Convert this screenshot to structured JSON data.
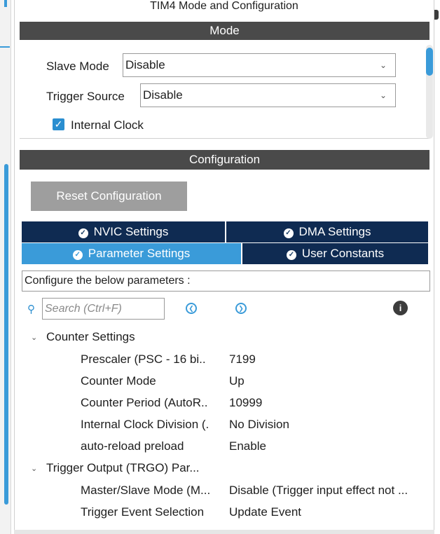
{
  "window": {
    "title": "TIM4 Mode and Configuration"
  },
  "mode_section": {
    "header": "Mode",
    "slave_mode": {
      "label": "Slave Mode",
      "value": "Disable"
    },
    "trigger_source": {
      "label": "Trigger Source",
      "value": "Disable"
    },
    "internal_clock": {
      "label": "Internal Clock",
      "checked": true
    }
  },
  "configuration_section": {
    "header": "Configuration",
    "reset_button": "Reset Configuration",
    "tabs": [
      {
        "label": "NVIC Settings",
        "active": false
      },
      {
        "label": "DMA Settings",
        "active": false
      },
      {
        "label": "Parameter Settings",
        "active": true
      },
      {
        "label": "User Constants",
        "active": false
      }
    ],
    "configure_text": "Configure the below parameters :",
    "search_placeholder": "Search (Ctrl+F)",
    "groups": [
      {
        "title": "Counter Settings",
        "params": [
          {
            "name": "Prescaler (PSC - 16 bi..",
            "value": "7199"
          },
          {
            "name": "Counter Mode",
            "value": "Up"
          },
          {
            "name": "Counter Period (AutoR..",
            "value": "10999"
          },
          {
            "name": "Internal Clock Division (.",
            "value": "No Division"
          },
          {
            "name": "auto-reload preload",
            "value": "Enable"
          }
        ]
      },
      {
        "title": "Trigger Output (TRGO) Par...",
        "params": [
          {
            "name": "Master/Slave Mode (M...",
            "value": "Disable (Trigger input effect not ..."
          },
          {
            "name": "Trigger Event Selection",
            "value": "Update Event"
          }
        ]
      }
    ]
  },
  "colors": {
    "header_bar": "#4a4a4a",
    "tab_dark": "#0f2b52",
    "tab_active": "#3a9bd9",
    "accent": "#2a8ed0",
    "button_gray": "#9e9e9e"
  },
  "icons": {
    "check": "check-circle-icon",
    "search": "search-icon",
    "nav_prev": "previous-circle-icon",
    "nav_next": "next-circle-icon",
    "info": "info-icon",
    "chevron": "chevron-down-icon"
  }
}
